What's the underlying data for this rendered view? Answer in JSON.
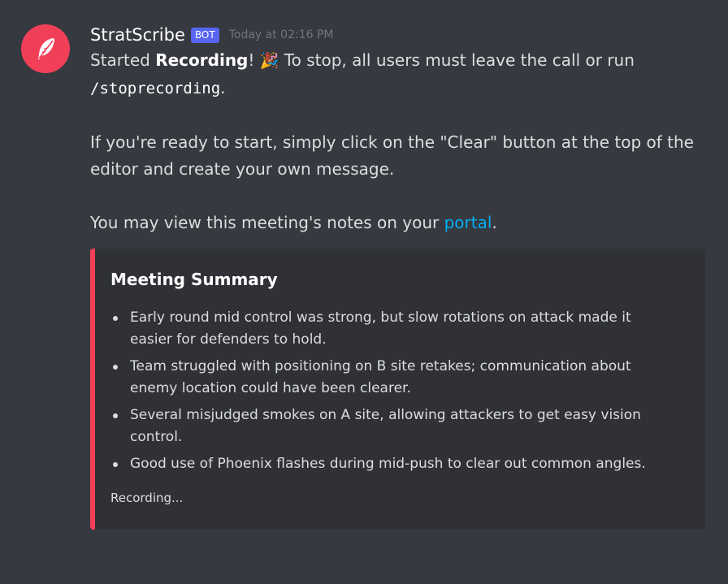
{
  "message": {
    "author": "StratScribe",
    "badge": "BOT",
    "timestamp": "Today at 02:16 PM",
    "avatar_icon": "feather-icon",
    "avatar_color": "#f23f58",
    "lines": {
      "l1_pre": "Started ",
      "l1_bold": "Recording",
      "l1_post": "! ",
      "l1_emoji": "🎉",
      "l1_rest": " To stop, all users must leave the call or run",
      "l2_code": "/stoprecording",
      "l2_post": ".",
      "p2_a": "If you're ready to start, simply click on the \"Clear\" button at the top of the",
      "p2_b": "editor and create your own message.",
      "p3_pre": "You may view this meeting's notes on your ",
      "p3_link": "portal",
      "p3_post": "."
    }
  },
  "embed": {
    "accent_color": "#f23f58",
    "title": "Meeting Summary",
    "bullets": [
      "Early round mid control was strong, but slow rotations on attack made it easier for defenders to hold.",
      "Team struggled with positioning on B site retakes; communication about enemy location could have been clearer.",
      "Several misjudged smokes on A site, allowing attackers to get easy vision control.",
      "Good use of Phoenix flashes during mid-push to clear out common angles."
    ],
    "footer": "Recording..."
  }
}
